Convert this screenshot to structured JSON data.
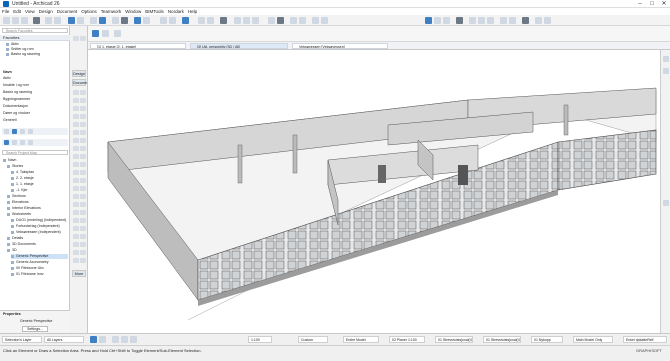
{
  "window": {
    "title": "Untitled - Archicad 26",
    "controls": [
      "–",
      "□",
      "✕"
    ]
  },
  "menu": [
    "File",
    "Edit",
    "View",
    "Design",
    "Document",
    "Options",
    "Teamwork",
    "Window",
    "BIMTools",
    "Nordark",
    "Help"
  ],
  "view_tabs": [
    "[1] 1. etasje [2. 1. etasje]",
    "[3] Ukj. perspektiv [3D / All]",
    "Veksøvessen [Veksøvessen]"
  ],
  "navigator": {
    "panel_title": "Favorites",
    "search_favorites": "Search Favorites",
    "favorites": [
      "Aktiv",
      "Snitter og rom",
      "Basisr og rasering"
    ],
    "views_list": [
      "Navn",
      "Aktiv",
      "Innakte i og rom",
      "Basisr og rasering",
      "Bygningsrammer",
      "Dokumentasjon",
      "Dører og vinduer",
      "Generell"
    ],
    "project_search": "Search Project Map",
    "tree": [
      {
        "label": "Navn",
        "indent": 0
      },
      {
        "label": "Stories",
        "indent": 1
      },
      {
        "label": "4. Taksplan",
        "indent": 2
      },
      {
        "label": "2. 2. etasje",
        "indent": 2
      },
      {
        "label": "1. 1. etasje",
        "indent": 2
      },
      {
        "label": "-1. Kjer",
        "indent": 2
      },
      {
        "label": "Sections",
        "indent": 1
      },
      {
        "label": "Elevations",
        "indent": 1
      },
      {
        "label": "Interior Elevations",
        "indent": 1
      },
      {
        "label": "Worksheets",
        "indent": 1
      },
      {
        "label": "DUO1 (endeling) (Independent)",
        "indent": 2
      },
      {
        "label": "Fortunderlag (Independent)",
        "indent": 2
      },
      {
        "label": "Veksøvessen (Independent)",
        "indent": 2
      },
      {
        "label": "Details",
        "indent": 1
      },
      {
        "label": "3D Documents",
        "indent": 1
      },
      {
        "label": "3D",
        "indent": 1
      },
      {
        "label": "Generic Perspective",
        "indent": 2
      },
      {
        "label": "Generic Axonometry",
        "indent": 2
      },
      {
        "label": "00 Fiteksone Ukv",
        "indent": 2
      },
      {
        "label": "01 Filetoane Innv",
        "indent": 2
      }
    ],
    "properties_label": "Properties",
    "properties_value": "Generic Perspective",
    "settings_label": "Settings..."
  },
  "toolbox": {
    "labels": [
      "Design",
      "Docume",
      "More"
    ]
  },
  "bottombar": [
    "1:100",
    "Custom",
    "Entire Model",
    "02 Planer 1:100",
    "01 Stressfunksjonal(4)",
    "01 Stressfunksjonal(4)",
    "01 Nykopp",
    "Main Model Only",
    "Enkel dpkatteRelf"
  ],
  "leftbottom": {
    "selection": "Selection's Layer",
    "all_layers": "All Layers"
  },
  "status": {
    "message": "Click an Element or Draw a Selection Area. Press and Hold Ctrl+Shift to Toggle Element/Sub-Element Selection.",
    "brand": "GRAPHISOFT"
  },
  "colors": {
    "accent": "#3f7fc4",
    "wall_top": "#d9d9d9",
    "wall_side": "#bdbdbd",
    "floor": "#f3f3f3",
    "window": "#6f7a82"
  }
}
